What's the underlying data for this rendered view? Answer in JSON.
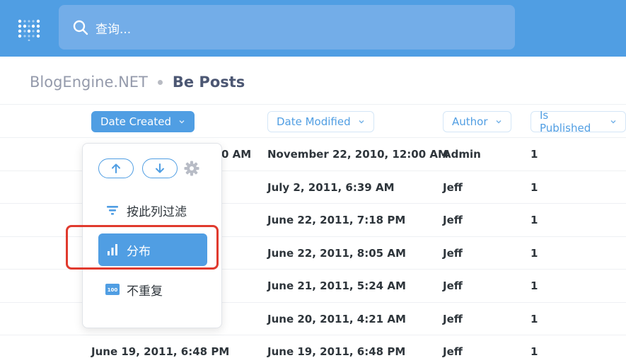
{
  "search": {
    "placeholder": "查询..."
  },
  "breadcrumb": {
    "database": "BlogEngine.NET",
    "table": "Be Posts"
  },
  "columns": [
    {
      "label": "Date Created",
      "active": true
    },
    {
      "label": "Date Modified",
      "active": false
    },
    {
      "label": "Author",
      "active": false
    },
    {
      "label": "Is Published",
      "active": false
    }
  ],
  "rows": [
    {
      "date_created_fragment": "0 AM",
      "date_modified": "November 22, 2010, 12:00 AM",
      "author": "Admin",
      "is_published": "1"
    },
    {
      "date_modified": "July 2, 2011, 6:39 AM",
      "author": "Jeff",
      "is_published": "1"
    },
    {
      "date_modified": "June 22, 2011, 7:18 PM",
      "author": "Jeff",
      "is_published": "1"
    },
    {
      "date_modified": "June 22, 2011, 8:05 AM",
      "author": "Jeff",
      "is_published": "1"
    },
    {
      "date_modified": "June 21, 2011, 5:24 AM",
      "author": "Jeff",
      "is_published": "1"
    },
    {
      "date_modified": "June 20, 2011, 4:21 AM",
      "author": "Jeff",
      "is_published": "1"
    },
    {
      "date_created": "June 19, 2011, 6:48 PM",
      "date_modified": "June 19, 2011, 6:48 PM",
      "author": "Jeff",
      "is_published": "1"
    }
  ],
  "popover": {
    "sort_ascending_icon": "arrow-up-icon",
    "sort_descending_icon": "arrow-down-icon",
    "settings_icon": "gear-icon",
    "filter_label": "按此列过滤",
    "distribution_label": "分布",
    "distinct_label": "不重复"
  },
  "colors": {
    "accent": "#509ee3",
    "highlight": "#e03a2e",
    "text": "#2e353b"
  }
}
